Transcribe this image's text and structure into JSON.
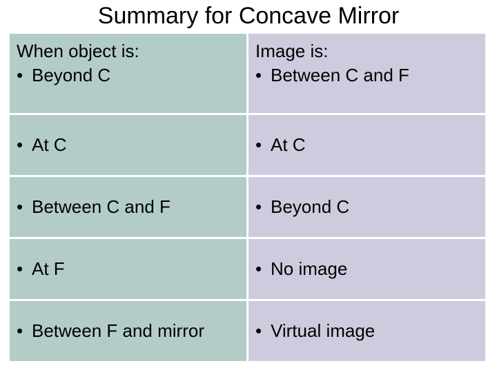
{
  "title": "Summary for Concave Mirror",
  "headers": {
    "left": "When object is:",
    "right": "Image is:"
  },
  "rows": [
    {
      "object": "Beyond C",
      "image": "Between C and F"
    },
    {
      "object": "At C",
      "image": "At C"
    },
    {
      "object": "Between C and F",
      "image": "Beyond C"
    },
    {
      "object": "At F",
      "image": "No image"
    },
    {
      "object": "Between F and mirror",
      "image": "Virtual image"
    }
  ],
  "chart_data": {
    "type": "table",
    "title": "Summary for Concave Mirror",
    "columns": [
      "When object is:",
      "Image is:"
    ],
    "rows": [
      [
        "Beyond C",
        "Between C and F"
      ],
      [
        "At C",
        "At C"
      ],
      [
        "Between C and F",
        "Beyond C"
      ],
      [
        "At F",
        "No image"
      ],
      [
        "Between F and mirror",
        "Virtual image"
      ]
    ]
  }
}
